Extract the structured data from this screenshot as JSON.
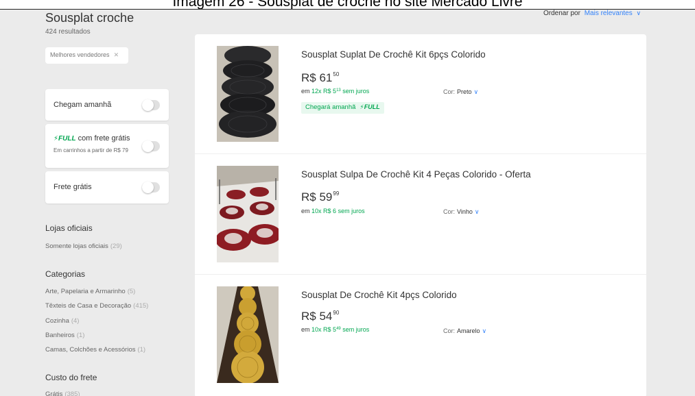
{
  "caption": "Imagem 26 - Sousplat de crochê no site Mercado Livre",
  "search": {
    "title": "Sousplat croche",
    "results_count": "424 resultados",
    "sort_label": "Ordenar por",
    "sort_value": "Mais relevantes"
  },
  "applied_filter": {
    "label": "Melhores vendedores"
  },
  "toggles": [
    {
      "label": "Chegam amanhã"
    },
    {
      "logo": "FULL",
      "label": "com frete grátis",
      "sub": "Em carrinhos a partir de R$ 79"
    },
    {
      "label": "Frete grátis"
    }
  ],
  "official_stores": {
    "title": "Lojas oficiais",
    "link": "Somente lojas oficiais",
    "count": "(29)"
  },
  "categories": {
    "title": "Categorias",
    "items": [
      {
        "label": "Arte, Papelaria e Armarinho",
        "count": "(5)"
      },
      {
        "label": "Têxteis de Casa e Decoração",
        "count": "(415)"
      },
      {
        "label": "Cozinha",
        "count": "(4)"
      },
      {
        "label": "Banheiros",
        "count": "(1)"
      },
      {
        "label": "Camas, Colchões e Acessórios",
        "count": "(1)"
      }
    ]
  },
  "shipping_cost": {
    "title": "Custo do frete",
    "items": [
      {
        "label": "Grátis",
        "count": "(385)"
      }
    ]
  },
  "products": [
    {
      "title": "Sousplat Suplat De Crochê Kit 6pçs Colorido",
      "price_currency": "R$",
      "price_int": "61",
      "price_cents": "50",
      "installments_em": "em",
      "installments_main": "12x R$ 5",
      "installments_cents": "13",
      "installments_suffix": "sem juros",
      "color_label": "Cor:",
      "color_value": "Preto",
      "shipping_badge": "Chegará amanhã",
      "shipping_logo": "FULL"
    },
    {
      "title": "Sousplat Sulpa De Crochê Kit 4 Peças Colorido - Oferta",
      "price_currency": "R$",
      "price_int": "59",
      "price_cents": "99",
      "installments_em": "em",
      "installments_main": "10x R$ 6",
      "installments_cents": "",
      "installments_suffix": "sem juros",
      "color_label": "Cor:",
      "color_value": "Vinho"
    },
    {
      "title": "Sousplat De Crochê Kit 4pçs Colorido",
      "price_currency": "R$",
      "price_int": "54",
      "price_cents": "90",
      "installments_em": "em",
      "installments_main": "10x R$ 5",
      "installments_cents": "49",
      "installments_suffix": "sem juros",
      "color_label": "Cor:",
      "color_value": "Amarelo"
    }
  ],
  "icons": {
    "remove": "✕",
    "chevron": "⌄",
    "bolt": "⚡"
  },
  "colors": {
    "accent_blue": "#3483fa",
    "green": "#00a650",
    "background": "#ebebeb"
  }
}
